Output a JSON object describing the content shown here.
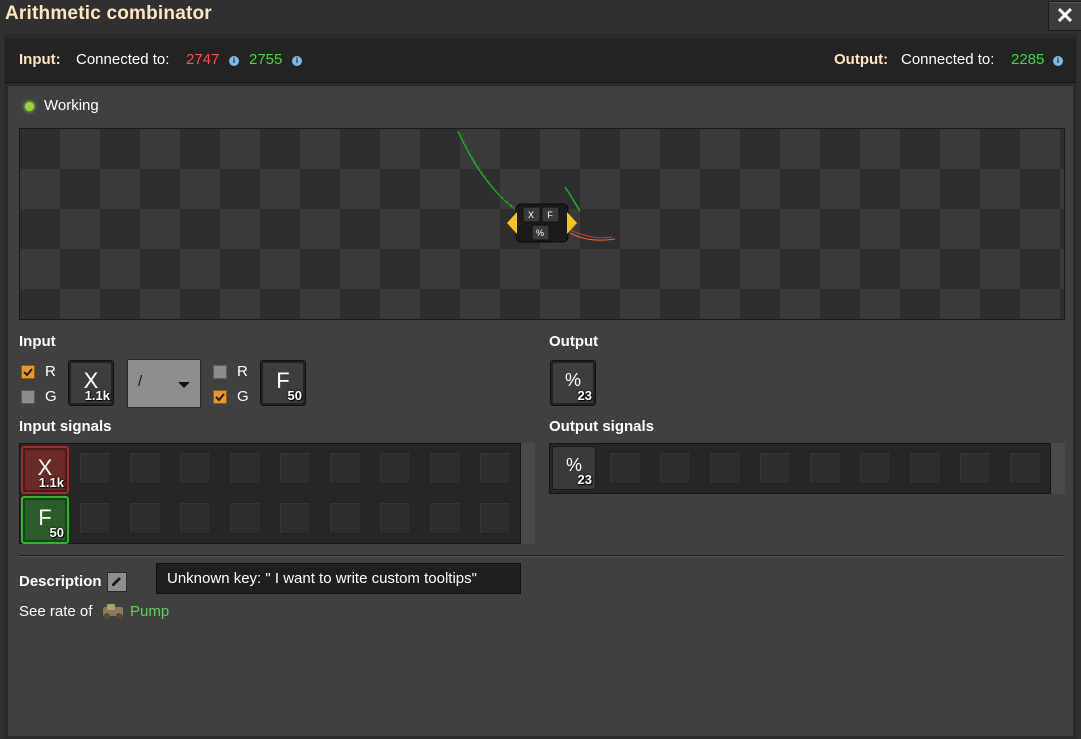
{
  "window": {
    "title": "Arithmetic combinator",
    "close_symbol": "✕"
  },
  "header": {
    "input_label": "Input:",
    "input_connected_to": "Connected to:",
    "input_red_id": "2747",
    "input_green_id": "2755",
    "output_label": "Output:",
    "output_connected_to": "Connected to:",
    "output_green_id": "2285",
    "info_glyph": "i"
  },
  "status": {
    "text": "Working"
  },
  "preview": {
    "combinator_display": [
      "X",
      "F",
      "%"
    ]
  },
  "input_section": {
    "label": "Input",
    "left_red_label": "R",
    "left_red_checked": true,
    "left_green_label": "G",
    "left_green_checked": false,
    "left_signal": {
      "glyph": "X",
      "count": "1.1k"
    },
    "operator": "/",
    "right_red_label": "R",
    "right_red_checked": false,
    "right_green_label": "G",
    "right_green_checked": true,
    "right_signal": {
      "glyph": "F",
      "count": "50"
    }
  },
  "output_section": {
    "label": "Output",
    "signal": {
      "glyph": "%",
      "count": "23"
    }
  },
  "input_signals": {
    "label": "Input signals",
    "items": [
      {
        "glyph": "X",
        "count": "1.1k",
        "wire": "red"
      },
      {
        "glyph": "F",
        "count": "50",
        "wire": "green"
      }
    ]
  },
  "output_signals": {
    "label": "Output signals",
    "items": [
      {
        "glyph": "%",
        "count": "23"
      }
    ]
  },
  "description": {
    "label": "Description",
    "tooltip": "Unknown key: \" I want to write custom tooltips\"",
    "see_rate_prefix": "See rate of",
    "linked_entity": "Pump"
  },
  "colors": {
    "title": "#ffe6c0",
    "red_wire": "#ff4b4b",
    "green_wire": "#43d843",
    "checkbox_on": "#e39827"
  }
}
